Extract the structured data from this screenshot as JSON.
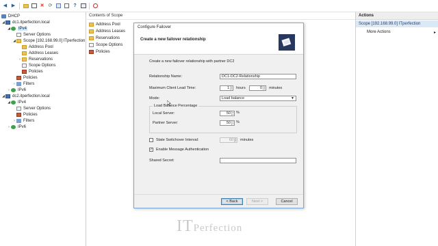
{
  "toolbar": {
    "icons": [
      "back-arrow",
      "forward-arrow",
      "folder",
      "console-tree",
      "delete",
      "refresh",
      "export",
      "properties",
      "help",
      "show-hide",
      "stop"
    ]
  },
  "tree": {
    "root": "DHCP",
    "server1": "dc1.itperfection.local",
    "ipv4": "IPv4",
    "server_options": "Server Options",
    "scope": "Scope [192.168.99.0] ITperfection",
    "address_pool": "Address Pool",
    "address_leases": "Address Leases",
    "reservations": "Reservations",
    "scope_options": "Scope Options",
    "scope_policies": "Policies",
    "policies": "Policies",
    "filters": "Filters",
    "ipv6": "IPv6",
    "server2": "dc2.itperfection.local",
    "ipv4_2": "IPv4",
    "server_options_2": "Server Options",
    "policies_2": "Policies",
    "filters_2": "Filters",
    "ipv6_2": "IPv6"
  },
  "content": {
    "header": "Contents of Scope",
    "items": [
      "Address Pool",
      "Address Leases",
      "Reservations",
      "Scope Options",
      "Policies"
    ]
  },
  "actions": {
    "header": "Actions",
    "scope_item": "Scope [192.168.99.0] ITperfection",
    "more_actions": "More Actions",
    "more_arrow": "▸"
  },
  "dialog": {
    "title": "Configure Failover",
    "heading": "Create a new failover relationship",
    "intro": "Create a new failover relationship with partner DC2",
    "relationship_name_label": "Relationship Name:",
    "relationship_name_value": "DC1-DC2-Relationship",
    "mclt_label": "Maximum Client Lead Time:",
    "mclt_hours": "1",
    "hours_label": "hours",
    "mclt_minutes": "0",
    "minutes_label": "minutes",
    "mode_label": "Mode:",
    "mode_value": "Load balance",
    "lb_group_title": "Load Balance Percentage",
    "local_server_label": "Local Server:",
    "local_server_value": "50",
    "partner_server_label": "Partner Server:",
    "partner_server_value": "50",
    "percent": "%",
    "switchover_label": "State Switchover Interval:",
    "switchover_value": "60",
    "switchover_minutes": "minutes",
    "switchover_checked": false,
    "auth_label": "Enable Message Authentication",
    "auth_checked": true,
    "auth_check_mark": "✓",
    "secret_label": "Shared Secret:",
    "secret_value": "",
    "back_button": "< Back",
    "next_button": "Next >",
    "cancel_button": "Cancel"
  },
  "watermark": {
    "it": "IT",
    "rest": "Perfection"
  },
  "colors": {
    "selection": "#cce8ff",
    "dialog_border": "#7aa7d6",
    "logo_bg": "#28375e",
    "actions_scope_bg": "#dbe8f6"
  }
}
